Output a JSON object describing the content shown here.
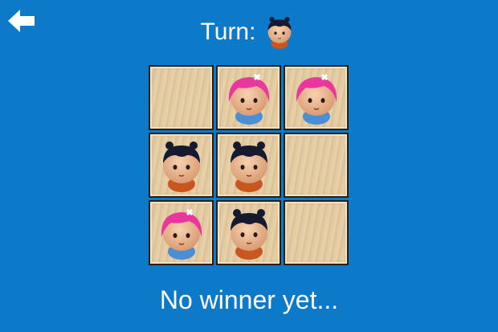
{
  "header": {
    "back_icon": "arrow-left-icon",
    "turn_label": "Turn:",
    "turn_player": "boy"
  },
  "board": {
    "cells": [
      [
        "",
        "girl",
        "girl"
      ],
      [
        "boy",
        "boy",
        ""
      ],
      [
        "girl",
        "boy",
        ""
      ]
    ]
  },
  "status": {
    "text": "No winner yet..."
  },
  "colors": {
    "background": "#0d7ac9",
    "board_border": "#2a1f14",
    "wood": "#e2c9a0",
    "boy_hair": "#151a2e",
    "boy_shirt": "#c8561f",
    "girl_hair": "#e8379d",
    "girl_shirt": "#4a8fd6"
  }
}
